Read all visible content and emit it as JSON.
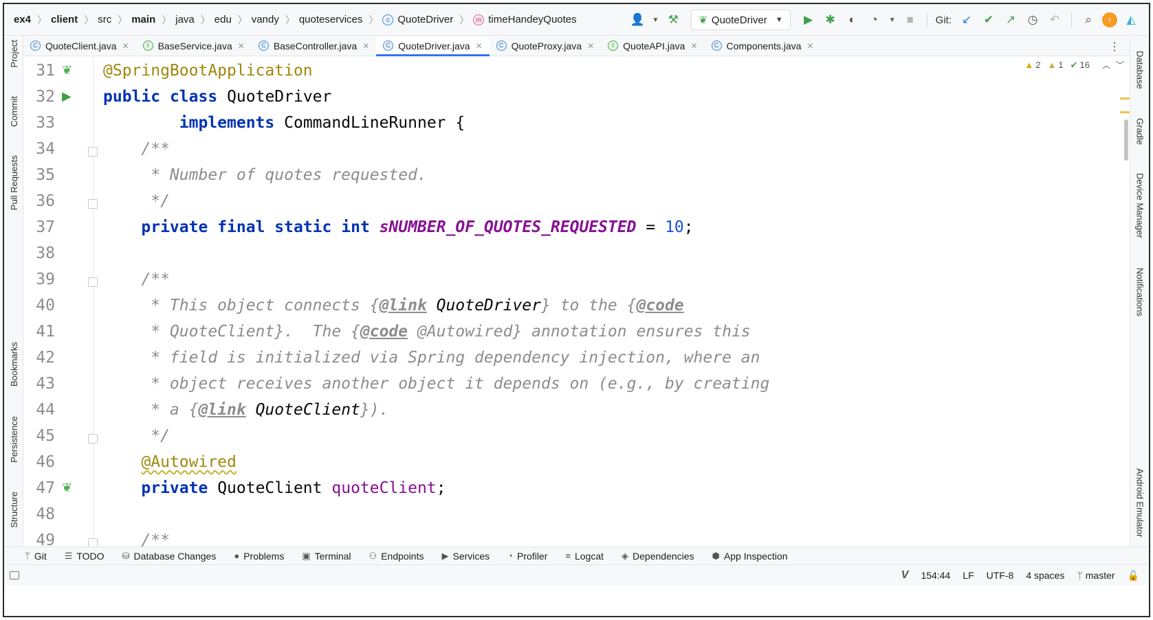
{
  "breadcrumbs": [
    {
      "label": "ex4",
      "bold": true
    },
    {
      "label": "client",
      "bold": true
    },
    {
      "label": "src",
      "bold": false
    },
    {
      "label": "main",
      "bold": true
    },
    {
      "label": "java",
      "bold": false
    },
    {
      "label": "edu",
      "bold": false
    },
    {
      "label": "vandy",
      "bold": false
    },
    {
      "label": "quoteservices",
      "bold": false
    },
    {
      "label": "QuoteDriver",
      "bold": false,
      "icon": "class-icon"
    },
    {
      "label": "timeHandeyQuotes",
      "bold": false,
      "icon": "method-icon"
    }
  ],
  "toolbar": {
    "run_config": "QuoteDriver",
    "git_label": "Git:"
  },
  "left_tools": [
    "Project",
    "Commit",
    "Pull Requests",
    "Bookmarks",
    "Persistence",
    "Structure"
  ],
  "right_tools": [
    "Database",
    "Gradle",
    "Device Manager",
    "Notifications",
    "Android Emulator"
  ],
  "tabs": [
    {
      "label": "QuoteClient.java",
      "kind": "C",
      "active": false
    },
    {
      "label": "BaseService.java",
      "kind": "I",
      "active": false
    },
    {
      "label": "BaseController.java",
      "kind": "C",
      "active": false
    },
    {
      "label": "QuoteDriver.java",
      "kind": "C",
      "active": true
    },
    {
      "label": "QuoteProxy.java",
      "kind": "C",
      "active": false
    },
    {
      "label": "QuoteAPI.java",
      "kind": "I",
      "active": false
    },
    {
      "label": "Components.java",
      "kind": "C",
      "active": false
    }
  ],
  "inspections": {
    "warnings": "2",
    "weak_warnings": "1",
    "ok": "16"
  },
  "code": {
    "line_numbers": [
      "31",
      "32",
      "33",
      "34",
      "35",
      "36",
      "37",
      "38",
      "39",
      "40",
      "41",
      "42",
      "43",
      "44",
      "45",
      "46",
      "47",
      "48",
      "49"
    ],
    "l31": "@SpringBootApplication",
    "l32_kw1": "public",
    "l32_kw2": "class",
    "l32_name": "QuoteDriver",
    "l33_kw": "implements",
    "l33_rest": "CommandLineRunner {",
    "l34": "/**",
    "l35": " * Number of quotes requested.",
    "l36": " */",
    "l37_kw1": "private",
    "l37_kw2": "final",
    "l37_kw3": "static",
    "l37_kw4": "int",
    "l37_field": "sNUMBER_OF_QUOTES_REQUESTED",
    "l37_eq": " = ",
    "l37_num": "10",
    "l37_end": ";",
    "l39": "/**",
    "l40_a": " * This object connects {",
    "l40_tag1": "@link",
    "l40_b": " QuoteDriver",
    "l40_c": "} to the {",
    "l40_tag2": "@code",
    "l41_a": " * QuoteClient}.  The {",
    "l41_tag": "@code",
    "l41_b": " @Autowired} annotation ensures this",
    "l42": " * field is initialized via Spring dependency injection, where an",
    "l43": " * object receives another object it depends on (e.g., by creating",
    "l44_a": " * a {",
    "l44_tag": "@link",
    "l44_b": " QuoteClient",
    "l44_c": "}).",
    "l45": " */",
    "l46": "@Autowired",
    "l47_kw": "private",
    "l47_type": "QuoteClient",
    "l47_field": "quoteClient",
    "l47_end": ";",
    "l49": "/**"
  },
  "bottom_tools": [
    "Git",
    "TODO",
    "Database Changes",
    "Problems",
    "Terminal",
    "Endpoints",
    "Services",
    "Profiler",
    "Logcat",
    "Dependencies",
    "App Inspection"
  ],
  "status": {
    "position": "154:44",
    "line_ending": "LF",
    "encoding": "UTF-8",
    "indent": "4 spaces",
    "branch": "master"
  },
  "colors": {
    "keyword": "#0033b3",
    "annotation": "#9e880d",
    "comment": "#8c8c8c",
    "static_field": "#871094",
    "number": "#1750eb",
    "active_tab_underline": "#3574f0"
  }
}
